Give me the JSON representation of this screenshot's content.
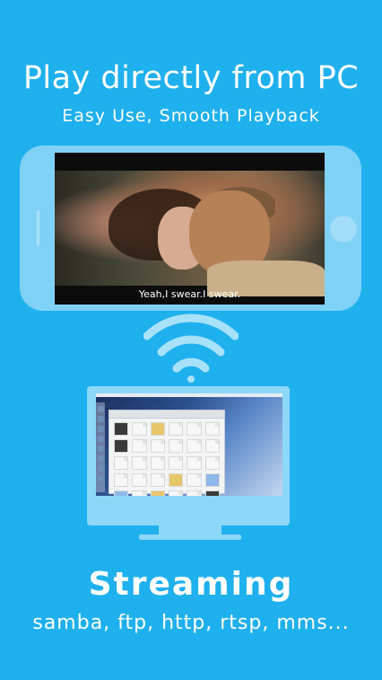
{
  "promo": {
    "headline": "Play directly from PC",
    "subheadline": "Easy Use, Smooth Playback",
    "video_subtitle": "Yeah,I swear.I swear.",
    "feature_title": "Streaming",
    "protocols": "samba, ftp, http, rtsp, mms..."
  },
  "colors": {
    "background": "#1fb0ee",
    "device_fill": "#7fd2f6",
    "monitor_fill": "#8dd8f8"
  },
  "icons": {
    "wifi": "wifi-icon"
  }
}
